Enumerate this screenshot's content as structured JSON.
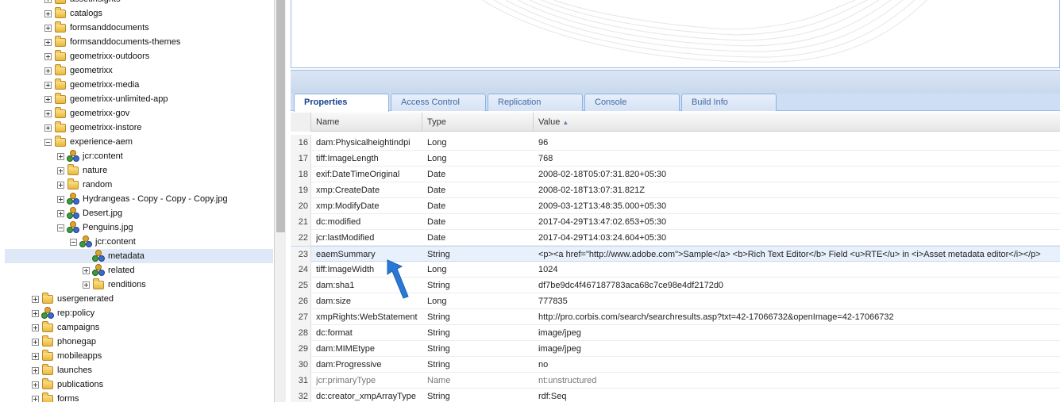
{
  "tree": {
    "nodes": [
      {
        "label": "assetinsights",
        "depth": 0,
        "icon": "folder",
        "toggle": "plus"
      },
      {
        "label": "catalogs",
        "depth": 0,
        "icon": "folder",
        "toggle": "plus"
      },
      {
        "label": "formsanddocuments",
        "depth": 0,
        "icon": "folder",
        "toggle": "plus"
      },
      {
        "label": "formsanddocuments-themes",
        "depth": 0,
        "icon": "folder",
        "toggle": "plus"
      },
      {
        "label": "geometrixx-outdoors",
        "depth": 0,
        "icon": "folder",
        "toggle": "plus"
      },
      {
        "label": "geometrixx",
        "depth": 0,
        "icon": "folder",
        "toggle": "plus"
      },
      {
        "label": "geometrixx-media",
        "depth": 0,
        "icon": "folder",
        "toggle": "plus"
      },
      {
        "label": "geometrixx-unlimited-app",
        "depth": 0,
        "icon": "folder",
        "toggle": "plus"
      },
      {
        "label": "geometrixx-gov",
        "depth": 0,
        "icon": "folder",
        "toggle": "plus"
      },
      {
        "label": "geometrixx-instore",
        "depth": 0,
        "icon": "folder",
        "toggle": "plus"
      },
      {
        "label": "experience-aem",
        "depth": 0,
        "icon": "folder",
        "toggle": "minus"
      },
      {
        "label": "jcr:content",
        "depth": 1,
        "icon": "node",
        "toggle": "plus"
      },
      {
        "label": "nature",
        "depth": 1,
        "icon": "folder",
        "toggle": "plus"
      },
      {
        "label": "random",
        "depth": 1,
        "icon": "folder",
        "toggle": "plus"
      },
      {
        "label": "Hydrangeas - Copy - Copy - Copy.jpg",
        "depth": 1,
        "icon": "node",
        "toggle": "plus"
      },
      {
        "label": "Desert.jpg",
        "depth": 1,
        "icon": "node",
        "toggle": "plus"
      },
      {
        "label": "Penguins.jpg",
        "depth": 1,
        "icon": "node",
        "toggle": "minus"
      },
      {
        "label": "jcr:content",
        "depth": 2,
        "icon": "node",
        "toggle": "minus"
      },
      {
        "label": "metadata",
        "depth": 3,
        "icon": "node",
        "toggle": "none",
        "selected": true
      },
      {
        "label": "related",
        "depth": 3,
        "icon": "node",
        "toggle": "plus"
      },
      {
        "label": "renditions",
        "depth": 3,
        "icon": "folder",
        "toggle": "plus"
      },
      {
        "label": "usergenerated",
        "depth": -1,
        "icon": "folder",
        "toggle": "plus"
      },
      {
        "label": "rep:policy",
        "depth": -1,
        "icon": "node",
        "toggle": "plus"
      },
      {
        "label": "campaigns",
        "depth": -1,
        "icon": "folder",
        "toggle": "plus"
      },
      {
        "label": "phonegap",
        "depth": -1,
        "icon": "folder",
        "toggle": "plus"
      },
      {
        "label": "mobileapps",
        "depth": -1,
        "icon": "folder",
        "toggle": "plus"
      },
      {
        "label": "launches",
        "depth": -1,
        "icon": "folder",
        "toggle": "plus"
      },
      {
        "label": "publications",
        "depth": -1,
        "icon": "folder",
        "toggle": "plus"
      },
      {
        "label": "forms",
        "depth": -1,
        "icon": "folder",
        "toggle": "plus"
      }
    ]
  },
  "tabs": [
    {
      "label": "Properties",
      "active": true
    },
    {
      "label": "Access Control",
      "active": false
    },
    {
      "label": "Replication",
      "active": false
    },
    {
      "label": "Console",
      "active": false
    },
    {
      "label": "Build Info",
      "active": false
    }
  ],
  "grid": {
    "headers": {
      "name": "Name",
      "type": "Type",
      "value": "Value"
    },
    "rows": [
      {
        "num": "16",
        "name": "dam:Physicalheightindpi",
        "type": "Long",
        "value": "96"
      },
      {
        "num": "17",
        "name": "tiff:ImageLength",
        "type": "Long",
        "value": "768"
      },
      {
        "num": "18",
        "name": "exif:DateTimeOriginal",
        "type": "Date",
        "value": "2008-02-18T05:07:31.820+05:30"
      },
      {
        "num": "19",
        "name": "xmp:CreateDate",
        "type": "Date",
        "value": "2008-02-18T13:07:31.821Z"
      },
      {
        "num": "20",
        "name": "xmp:ModifyDate",
        "type": "Date",
        "value": "2009-03-12T13:48:35.000+05:30"
      },
      {
        "num": "21",
        "name": "dc:modified",
        "type": "Date",
        "value": "2017-04-29T13:47:02.653+05:30"
      },
      {
        "num": "22",
        "name": "jcr:lastModified",
        "type": "Date",
        "value": "2017-04-29T14:03:24.604+05:30"
      },
      {
        "num": "23",
        "name": "eaemSummary",
        "type": "String",
        "value": "<p><a href=\"http://www.adobe.com\">Sample</a> <b>Rich Text Editor</b> Field <u>RTE</u> in <i>Asset metadata editor</i></p>",
        "highlight": true
      },
      {
        "num": "24",
        "name": "tiff:ImageWidth",
        "type": "Long",
        "value": "1024"
      },
      {
        "num": "25",
        "name": "dam:sha1",
        "type": "String",
        "value": "df7be9dc4f467187783aca68c7ce98e4df2172d0"
      },
      {
        "num": "26",
        "name": "dam:size",
        "type": "Long",
        "value": "777835"
      },
      {
        "num": "27",
        "name": "xmpRights:WebStatement",
        "type": "String",
        "value": "http://pro.corbis.com/search/searchresults.asp?txt=42-17066732&openImage=42-17066732"
      },
      {
        "num": "28",
        "name": "dc:format",
        "type": "String",
        "value": "image/jpeg"
      },
      {
        "num": "29",
        "name": "dam:MIMEtype",
        "type": "String",
        "value": "image/jpeg"
      },
      {
        "num": "30",
        "name": "dam:Progressive",
        "type": "String",
        "value": "no"
      },
      {
        "num": "31",
        "name": "jcr:primaryType",
        "type": "Name",
        "value": "nt:unstructured",
        "muted": true
      },
      {
        "num": "32",
        "name": "dc:creator_xmpArrayType",
        "type": "String",
        "value": "rdf:Seq"
      }
    ]
  },
  "colors": {
    "accent": "#15428b",
    "selection": "#dfe8f6",
    "highlight_row": "#e8f1fb",
    "annotation_arrow": "#2a78d6"
  }
}
